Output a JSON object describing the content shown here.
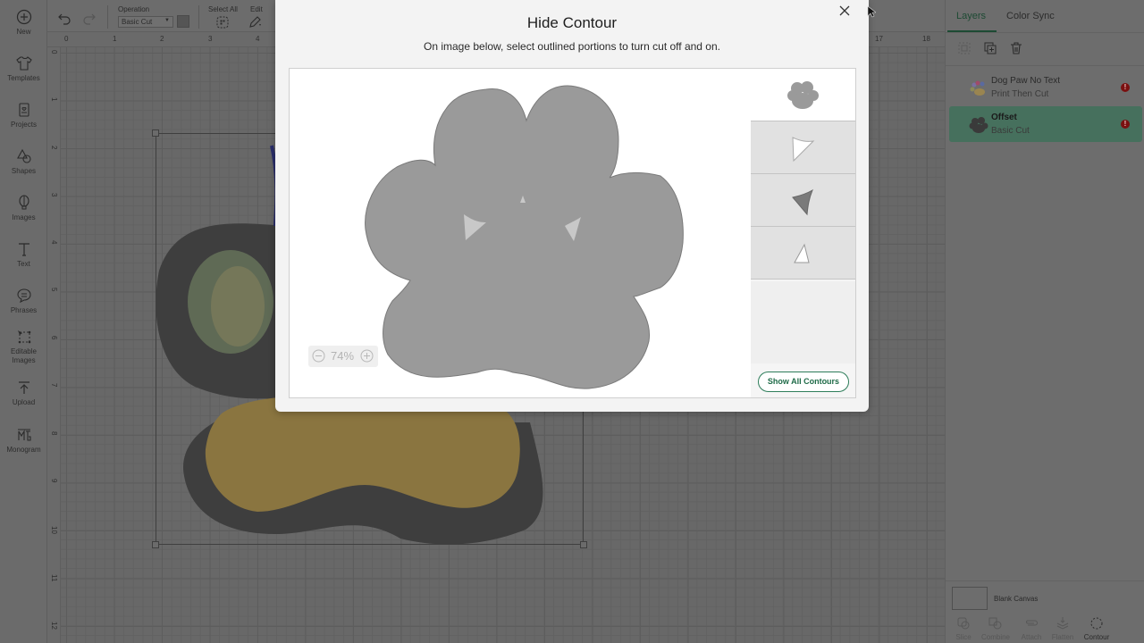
{
  "left_nav": {
    "items": [
      {
        "id": "new",
        "label": "New",
        "icon": "plus-circle-icon"
      },
      {
        "id": "templates",
        "label": "Templates",
        "icon": "tshirt-icon"
      },
      {
        "id": "projects",
        "label": "Projects",
        "icon": "project-card-icon"
      },
      {
        "id": "shapes",
        "label": "Shapes",
        "icon": "shapes-icon"
      },
      {
        "id": "images",
        "label": "Images",
        "icon": "balloon-icon"
      },
      {
        "id": "text",
        "label": "Text",
        "icon": "text-T-icon"
      },
      {
        "id": "phrases",
        "label": "Phrases",
        "icon": "speech-bubble-icon"
      },
      {
        "id": "editable-images",
        "label": "Editable Images",
        "icon": "editable-image-icon"
      },
      {
        "id": "upload",
        "label": "Upload",
        "icon": "upload-icon"
      },
      {
        "id": "monogram",
        "label": "Monogram",
        "icon": "monogram-icon"
      }
    ]
  },
  "toolbar": {
    "operation_label": "Operation",
    "operation_value": "Basic Cut",
    "operation_color": "#555555",
    "select_all_label": "Select All",
    "edit_label": "Edit"
  },
  "rulers": {
    "horizontal": [
      "0",
      "1",
      "2",
      "3",
      "4",
      "17",
      "18"
    ],
    "vertical": [
      "0",
      "1",
      "2",
      "3",
      "4",
      "5",
      "6",
      "7",
      "8",
      "9",
      "10",
      "11",
      "12"
    ]
  },
  "right_panel": {
    "tabs": [
      {
        "label": "Layers",
        "active": true
      },
      {
        "label": "Color Sync",
        "active": false
      }
    ],
    "layers": [
      {
        "name": "Dog Paw No Text",
        "operation": "Print Then Cut",
        "selected": false,
        "warning": "!"
      },
      {
        "name": "Offset",
        "operation": "Basic Cut",
        "selected": true,
        "warning": "!"
      }
    ],
    "blank_canvas_label": "Blank Canvas",
    "bottom_tools": [
      {
        "label": "Slice",
        "icon": "slice-icon",
        "enabled": false
      },
      {
        "label": "Combine",
        "icon": "combine-icon",
        "enabled": false
      },
      {
        "label": "Attach",
        "icon": "attach-icon",
        "enabled": false
      },
      {
        "label": "Flatten",
        "icon": "flatten-icon",
        "enabled": false
      },
      {
        "label": "Contour",
        "icon": "contour-icon",
        "enabled": true
      }
    ]
  },
  "modal": {
    "title": "Hide Contour",
    "subtitle": "On image below, select outlined portions to turn cut off and on.",
    "zoom_value": "74%",
    "contours": [
      {
        "id": "outer-paw",
        "visible": true
      },
      {
        "id": "left-triangle",
        "visible": false
      },
      {
        "id": "right-triangle",
        "visible": true
      },
      {
        "id": "top-triangle",
        "visible": false
      }
    ],
    "show_all_label": "Show All Contours",
    "accent_color": "#1f6b48"
  }
}
